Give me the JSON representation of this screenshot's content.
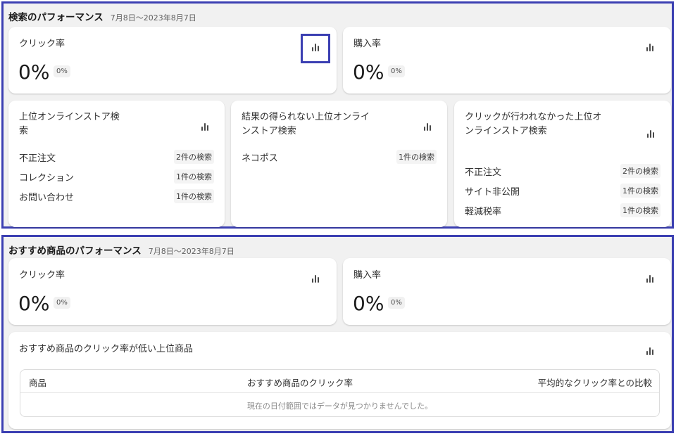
{
  "search_perf": {
    "title": "検索のパフォーマンス",
    "date": "7月8日〜2023年8月7日",
    "click_rate": {
      "label": "クリック率",
      "value": "0%",
      "change": "0%"
    },
    "purchase_rate": {
      "label": "購入率",
      "value": "0%",
      "change": "0%"
    },
    "top_searches": {
      "title_line1": "上位オンラインストア検",
      "title_line2": "索",
      "rows": [
        {
          "term": "不正注文",
          "count": "2件の検索"
        },
        {
          "term": "コレクション",
          "count": "1件の検索"
        },
        {
          "term": "お問い合わせ",
          "count": "1件の検索"
        }
      ]
    },
    "no_result_searches": {
      "title_line1": "結果の得られない上位オンライ",
      "title_line2": "ンストア検索",
      "rows": [
        {
          "term": "ネコポス",
          "count": "1件の検索"
        }
      ]
    },
    "no_click_searches": {
      "title_line1": "クリックが行われなかった上位オ",
      "title_line2": "ンラインストア検索",
      "rows": [
        {
          "term": "不正注文",
          "count": "2件の検索"
        },
        {
          "term": "サイト非公開",
          "count": "1件の検索"
        },
        {
          "term": "軽減税率",
          "count": "1件の検索"
        }
      ]
    }
  },
  "rec_perf": {
    "title": "おすすめ商品のパフォーマンス",
    "date": "7月8日〜2023年8月7日",
    "click_rate": {
      "label": "クリック率",
      "value": "0%",
      "change": "0%"
    },
    "purchase_rate": {
      "label": "購入率",
      "value": "0%",
      "change": "0%"
    },
    "low_ctr": {
      "title": "おすすめ商品のクリック率が低い上位商品",
      "columns": [
        "商品",
        "おすすめ商品のクリック率",
        "平均的なクリック率との比較"
      ],
      "empty_message": "現在の日付範囲ではデータが見つかりませんでした。"
    }
  },
  "icons": {
    "chart": "bar-chart-icon"
  },
  "colors": {
    "highlight": "#3b3fb2",
    "section_bg": "#f1f1f1",
    "card_bg": "#ffffff"
  }
}
